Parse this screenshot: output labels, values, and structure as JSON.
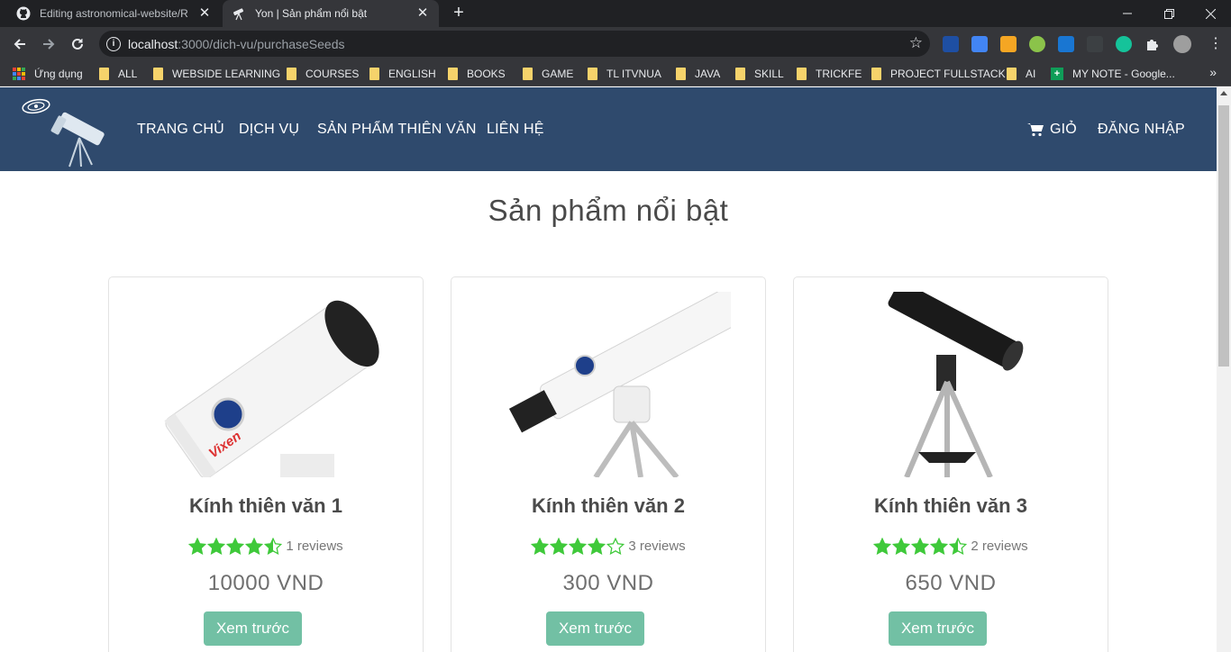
{
  "browser": {
    "tabs": [
      {
        "title": "Editing astronomical-website/RE",
        "active": false
      },
      {
        "title": "Yon | Sản phẩm nổi bật",
        "active": true
      }
    ],
    "address": {
      "host": "localhost",
      "path": ":3000/dich-vu/purchaseSeeds"
    },
    "bookmarks": [
      "Ứng dụng",
      "ALL",
      "WEBSIDE LEARNING",
      "COURSES",
      "ENGLISH",
      "BOOKS",
      "GAME",
      "TL ITVNUA",
      "JAVA",
      "SKILL",
      "TRICKFE",
      "PROJECT FULLSTACK",
      "AI",
      "MY NOTE - Google..."
    ],
    "bookmarks_more": "»",
    "newtab_glyph": "+",
    "close_glyph": "✕"
  },
  "site": {
    "nav": {
      "home": "TRANG CHỦ",
      "services": "DỊCH VỤ",
      "products": "SẢN PHẨM THIÊN VĂN",
      "contact": "LIÊN HỆ",
      "cart": "GIỎ",
      "login": "ĐĂNG NHẬP"
    },
    "section_title": "Sản phẩm nổi bật",
    "star_color": "#3fc93a",
    "nav_color": "#2f4a6d",
    "button_color": "#72c0a4",
    "products": [
      {
        "name": "Kính thiên văn 1",
        "rating": 4.5,
        "reviews": "1 reviews",
        "price": "10000 VND",
        "button": "Xem trước"
      },
      {
        "name": "Kính thiên văn 2",
        "rating": 4,
        "reviews": "3 reviews",
        "price": "300 VND",
        "button": "Xem trước"
      },
      {
        "name": "Kính thiên văn 3",
        "rating": 4.5,
        "reviews": "2 reviews",
        "price": "650 VND",
        "button": "Xem trước"
      }
    ]
  }
}
